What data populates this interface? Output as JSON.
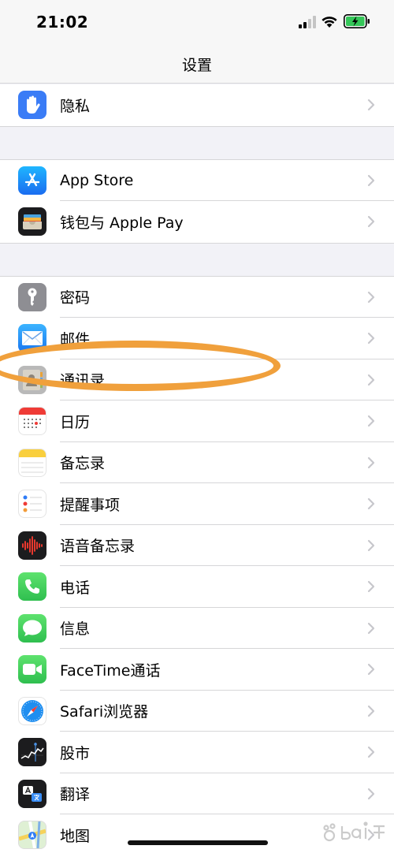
{
  "status_bar": {
    "time": "21:02",
    "signal_icon": "cellular-signal-icon",
    "wifi_icon": "wifi-icon",
    "battery_icon": "battery-charging-icon"
  },
  "nav": {
    "title": "设置"
  },
  "groups": [
    {
      "items": [
        {
          "label": "隐私",
          "icon": "hand-privacy-icon",
          "color": "#3a7cf6"
        }
      ]
    },
    {
      "items": [
        {
          "label": "App Store",
          "icon": "app-store-icon",
          "color": "#1a8cff"
        },
        {
          "label": "钱包与 Apple Pay",
          "icon": "wallet-icon",
          "color": "#1c1c1e"
        }
      ]
    },
    {
      "items": [
        {
          "label": "密码",
          "icon": "key-icon",
          "color": "#8e8e93"
        },
        {
          "label": "邮件",
          "icon": "mail-icon",
          "color": "#3a8ef6"
        },
        {
          "label": "通讯录",
          "icon": "contacts-icon",
          "color": "#a8a8a8"
        },
        {
          "label": "日历",
          "icon": "calendar-icon",
          "color": "#ffffff"
        },
        {
          "label": "备忘录",
          "icon": "notes-icon",
          "color": "#ffffff"
        },
        {
          "label": "提醒事项",
          "icon": "reminders-icon",
          "color": "#ffffff"
        },
        {
          "label": "语音备忘录",
          "icon": "voice-memos-icon",
          "color": "#1c1c1e"
        },
        {
          "label": "电话",
          "icon": "phone-icon",
          "color": "#34c759"
        },
        {
          "label": "信息",
          "icon": "messages-icon",
          "color": "#34c759"
        },
        {
          "label": "FaceTime通话",
          "icon": "facetime-icon",
          "color": "#34c759"
        },
        {
          "label": "Safari浏览器",
          "icon": "safari-compass-icon",
          "color": "#ffffff"
        },
        {
          "label": "股市",
          "icon": "stocks-icon",
          "color": "#1c1c1e"
        },
        {
          "label": "翻译",
          "icon": "translate-icon",
          "color": "#1c1c1e"
        },
        {
          "label": "地图",
          "icon": "maps-icon",
          "color": "#e8f4e0"
        }
      ]
    }
  ],
  "colors": {
    "highlight": "#f0a03c",
    "chevron": "#c7c7cc",
    "separator": "#d6d6d8"
  },
  "watermark": {
    "icon": "baidu-jingyan-watermark-icon"
  }
}
